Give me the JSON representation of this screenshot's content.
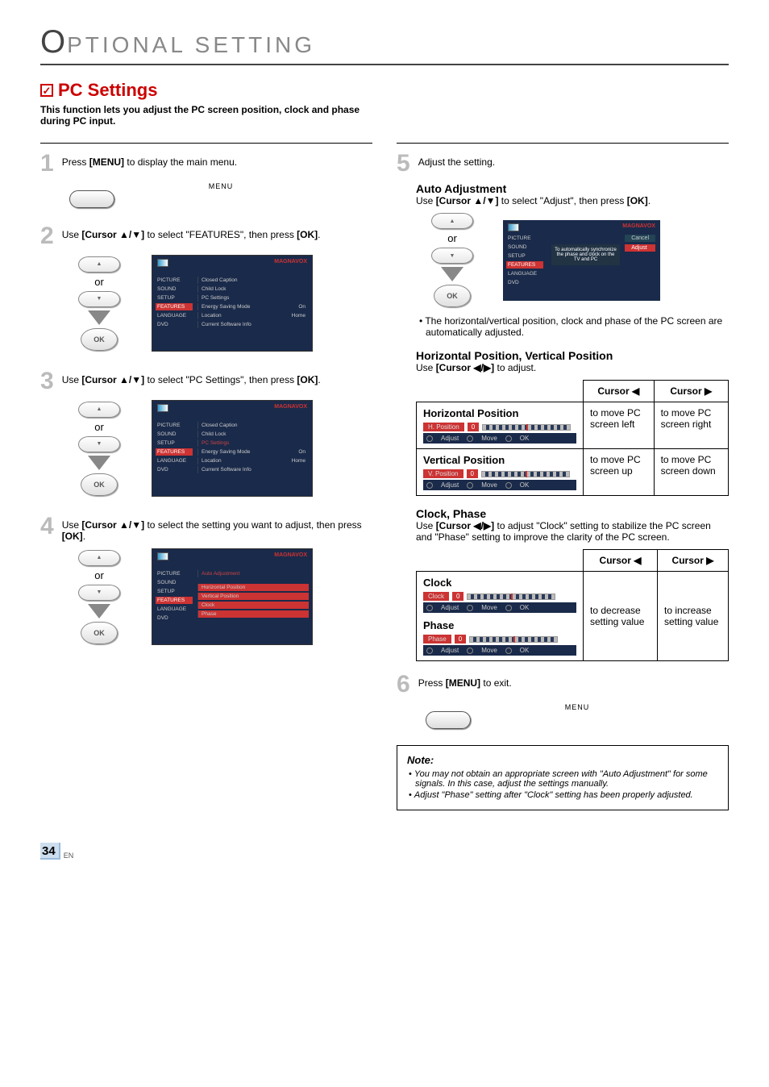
{
  "chapter": {
    "first_letter": "O",
    "rest": "PTIONAL  SETTING"
  },
  "section_title": "PC Settings",
  "intro": "This function lets you adjust the PC screen position, clock and phase during PC input.",
  "steps": {
    "s1": {
      "num": "1",
      "pre": "Press ",
      "bold": "[MENU]",
      "post": " to display the main menu."
    },
    "s2": {
      "num": "2",
      "pre": "Use ",
      "bold": "[Cursor ▲/▼]",
      "mid": " to select \"FEATURES\", then press ",
      "bold2": "[OK]",
      "post2": "."
    },
    "s3": {
      "num": "3",
      "pre": "Use ",
      "bold": "[Cursor ▲/▼]",
      "mid": " to select \"PC Settings\", then press ",
      "bold2": "[OK]",
      "post2": "."
    },
    "s4": {
      "num": "4",
      "pre": "Use ",
      "bold": "[Cursor ▲/▼]",
      "mid": " to select the setting you want to adjust, then press ",
      "bold2": "[OK]",
      "post2": "."
    },
    "s5": {
      "num": "5",
      "text": "Adjust the setting."
    },
    "s6": {
      "num": "6",
      "pre": "Press ",
      "bold": "[MENU]",
      "post": " to exit."
    }
  },
  "menu_label": "MENU",
  "or_label": "or",
  "ok_label": "OK",
  "tv": {
    "brand": "MAGNAVOX",
    "side": [
      "PICTURE",
      "SOUND",
      "SETUP",
      "FEATURES",
      "LANGUAGE",
      "DVD"
    ],
    "features_menu": [
      [
        "Closed Caption",
        ""
      ],
      [
        "Child Lock",
        ""
      ],
      [
        "PC Settings",
        ""
      ],
      [
        "Energy Saving Mode",
        "On"
      ],
      [
        "Location",
        "Home"
      ],
      [
        "Current Software Info",
        ""
      ]
    ],
    "pc_menu_items": [
      "Auto Adjustment",
      "",
      "Horizontal Position",
      "Vertical Position",
      "Clock",
      "Phase"
    ]
  },
  "auto": {
    "head": "Auto Adjustment",
    "text_pre": "Use ",
    "text_bold": "[Cursor ▲/▼]",
    "text_post": " to select \"Adjust\", then press ",
    "text_bold2": "[OK]",
    "text_post2": ".",
    "box_mid": "To automatically synchronize the phase and clock on the TV and PC",
    "cancel": "Cancel",
    "adjust": "Adjust",
    "bullet": "The horizontal/vertical position, clock and phase of the PC screen are automatically adjusted."
  },
  "hvpos": {
    "head": "Horizontal Position, Vertical Position",
    "text_pre": "Use ",
    "text_bold": "[Cursor ◀/▶]",
    "text_post": " to adjust.",
    "th_left": "Cursor ◀",
    "th_right": "Cursor ▶",
    "h_label": "Horizontal Position",
    "h_osd": "H. Position",
    "osd_zero": "0",
    "h_left": "to move PC screen left",
    "h_right": "to move PC screen right",
    "v_label": "Vertical Position",
    "v_osd": "V. Position",
    "v_left": "to move PC screen up",
    "v_right": "to move PC screen down",
    "osd_adjust": "Adjust",
    "osd_move": "Move",
    "osd_ok": "OK"
  },
  "clockphase": {
    "head": "Clock, Phase",
    "text_pre": "Use ",
    "text_bold": "[Cursor ◀/▶]",
    "text_post": " to adjust \"Clock\" setting to stabilize the PC screen and \"Phase\" setting to improve the clarity of the PC screen.",
    "th_left": "Cursor ◀",
    "th_right": "Cursor ▶",
    "c_label": "Clock",
    "c_osd": "Clock",
    "p_label": "Phase",
    "p_osd": "Phase",
    "left_text": "to decrease setting value",
    "right_text": "to increase setting value"
  },
  "note": {
    "title": "Note:",
    "n1": "You may not obtain an appropriate screen with \"Auto Adjustment\" for some signals. In this case, adjust the settings manually.",
    "n2": "Adjust \"Phase\" setting after \"Clock\" setting has been properly adjusted."
  },
  "page": {
    "num": "34",
    "lang": "EN"
  }
}
